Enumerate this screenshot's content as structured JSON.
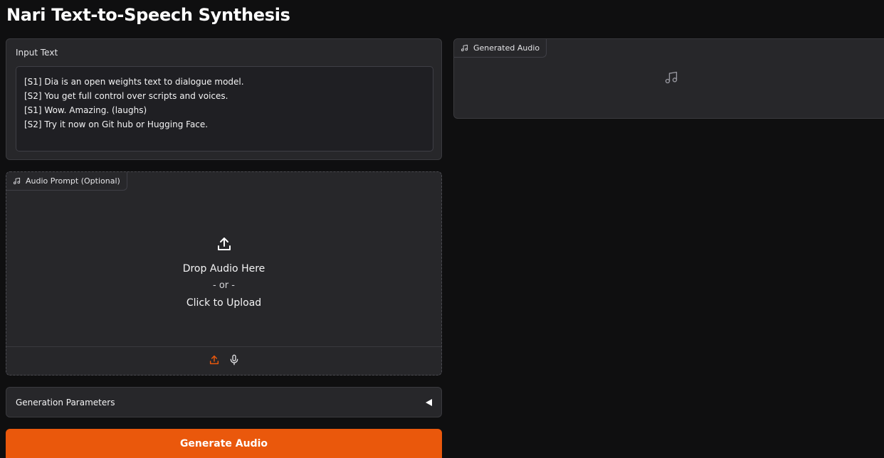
{
  "app": {
    "title": "Nari Text-to-Speech Synthesis"
  },
  "input_text": {
    "label": "Input Text",
    "value": "[S1] Dia is an open weights text to dialogue model.\n[S2] You get full control over scripts and voices.\n[S1] Wow. Amazing. (laughs)\n[S2] Try it now on Git hub or Hugging Face."
  },
  "audio_prompt": {
    "label": "Audio Prompt (Optional)",
    "icon": "music-note-icon",
    "drop_text": "Drop Audio Here",
    "or_text": "- or -",
    "upload_text": "Click to Upload",
    "sources": [
      {
        "name": "upload",
        "icon": "upload-icon",
        "active": true
      },
      {
        "name": "microphone",
        "icon": "microphone-icon",
        "active": false
      }
    ]
  },
  "generation_parameters": {
    "label": "Generation Parameters",
    "expanded": false
  },
  "generate_button": {
    "label": "Generate Audio"
  },
  "generated_audio": {
    "label": "Generated Audio",
    "icon": "music-note-icon",
    "empty_icon": "music-note-icon"
  },
  "colors": {
    "accent": "#ea580c",
    "background": "#0f0f10",
    "panel": "#27272a"
  }
}
